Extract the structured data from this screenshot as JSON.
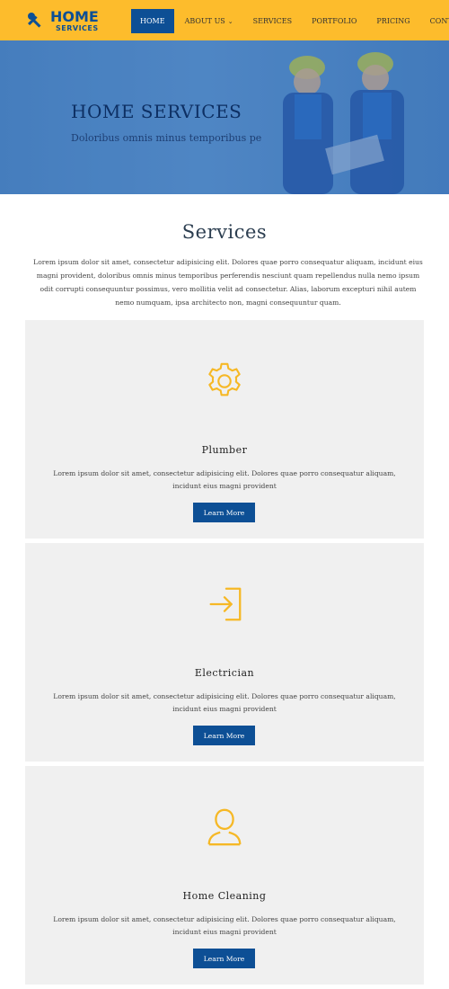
{
  "brand": {
    "name_main": "HOME",
    "name_sub": "SERVICES"
  },
  "nav": {
    "items": [
      {
        "label": "HOME"
      },
      {
        "label": "ABOUT US"
      },
      {
        "label": "SERVICES"
      },
      {
        "label": "PORTFOLIO"
      },
      {
        "label": "PRICING"
      },
      {
        "label": "CONTACT"
      }
    ]
  },
  "hero": {
    "title": "HOME SERVICES",
    "subtitle": "Doloribus omnis minus temporibus pe"
  },
  "services": {
    "heading": "Services",
    "intro": "Lorem ipsum dolor sit amet, consectetur adipisicing elit. Dolores quae porro consequatur aliquam, incidunt eius magni provident, doloribus omnis minus temporibus perferendis nesciunt quam repellendus nulla nemo ipsum odit corrupti consequuntur possimus, vero mollitia velit ad consectetur. Alias, laborum excepturi nihil autem nemo numquam, ipsa architecto non, magni consequuntur quam.",
    "cards": [
      {
        "title": "Plumber",
        "description": "Lorem ipsum dolor sit amet, consectetur adipisicing elit. Dolores quae porro consequatur aliquam, incidunt eius magni provident",
        "button": "Learn More",
        "icon": "gear-icon"
      },
      {
        "title": "Electrician",
        "description": "Lorem ipsum dolor sit amet, consectetur adipisicing elit. Dolores quae porro consequatur aliquam, incidunt eius magni provident",
        "button": "Learn More",
        "icon": "login-arrow-icon"
      },
      {
        "title": "Home Cleaning",
        "description": "Lorem ipsum dolor sit amet, consectetur adipisicing elit. Dolores quae porro consequatur aliquam, incidunt eius magni provident",
        "button": "Learn More",
        "icon": "user-icon"
      }
    ]
  },
  "colors": {
    "header": "#FDBC2C",
    "primary": "#0d4f95",
    "accent": "#F6B825",
    "card": "#f0f0f0"
  }
}
